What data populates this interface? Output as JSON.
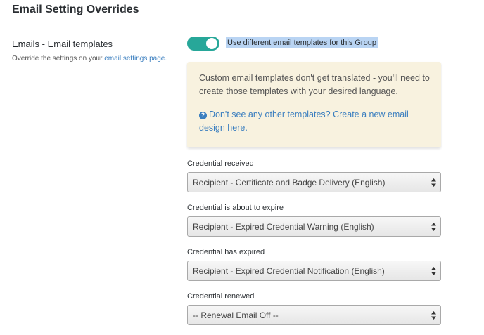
{
  "section": {
    "title": "Email Setting Overrides"
  },
  "emails": {
    "label_bold": "Emails",
    "label_rest": " - Email templates",
    "note_prefix": "Override the settings on your ",
    "note_link": "email settings page."
  },
  "toggle": {
    "label": "Use different email templates for this Group",
    "on": true
  },
  "notice": {
    "text": "Custom email templates don't get translated - you'll need to create those templates with your desired language.",
    "link": "Don't see any other templates? Create a new email design here."
  },
  "fields": [
    {
      "label": "Credential received",
      "value": "Recipient - Certificate and Badge Delivery (English)"
    },
    {
      "label": "Credential is about to expire",
      "value": "Recipient - Expired Credential Warning (English)"
    },
    {
      "label": "Credential has expired",
      "value": "Recipient - Expired Credential Notification (English)"
    },
    {
      "label": "Credential renewed",
      "value": "-- Renewal Email Off --"
    }
  ],
  "colors": {
    "toggle": "#27a799",
    "link": "#3a7ebf",
    "notice_bg": "#f8f2df",
    "highlight": "#b9d4f3"
  },
  "icons": {
    "help": "question-circle-icon",
    "select": "up-down-arrows-icon"
  }
}
